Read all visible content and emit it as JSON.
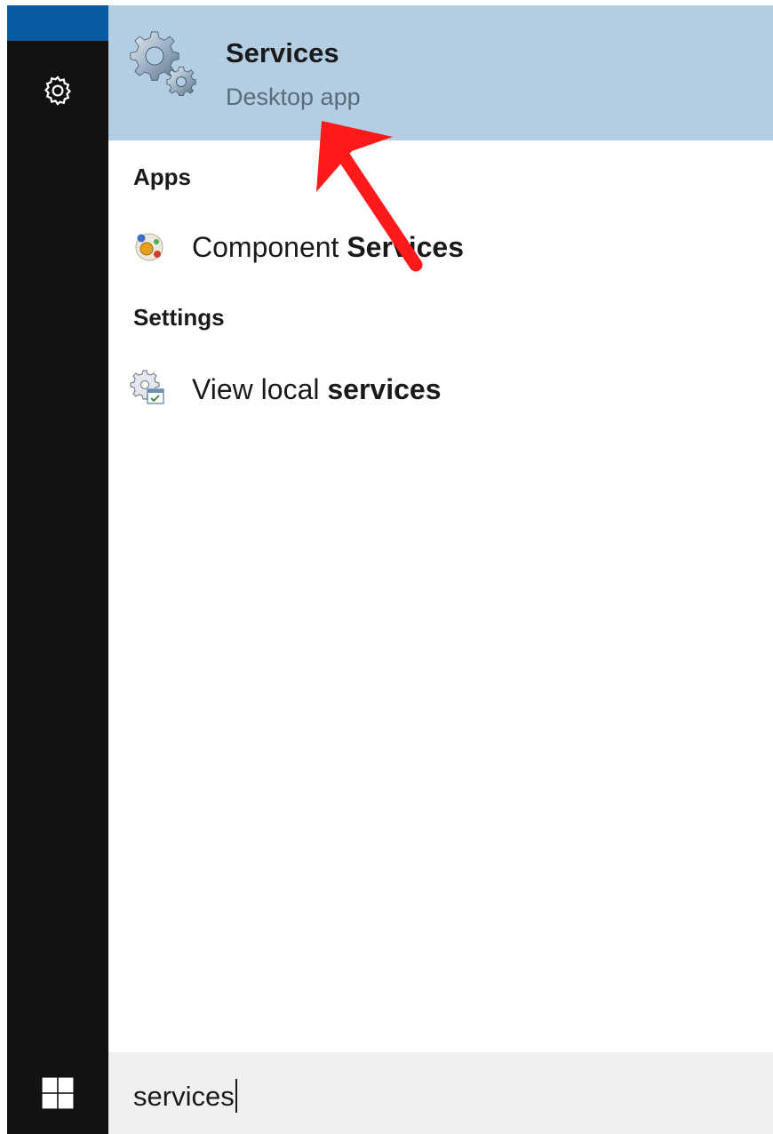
{
  "best_match": {
    "title": "Services",
    "subtitle": "Desktop app",
    "icon": "services-gears-icon"
  },
  "sections": {
    "apps_heading": "Apps",
    "settings_heading": "Settings"
  },
  "apps": [
    {
      "label_prefix": "Component ",
      "label_match": "Services",
      "icon": "component-services-icon"
    }
  ],
  "settings": [
    {
      "label_prefix": "View local ",
      "label_match": "services",
      "icon": "settings-gear-icon"
    }
  ],
  "search": {
    "query": "services"
  },
  "rail": {
    "settings_icon": "gear-icon",
    "start_icon": "windows-logo-icon"
  },
  "colors": {
    "rail": "#121212",
    "accent": "#0a5aa0",
    "best_match_highlight": "#b3cde2",
    "search_bar": "#f0f0f0",
    "annotation_arrow": "#ff0000"
  }
}
